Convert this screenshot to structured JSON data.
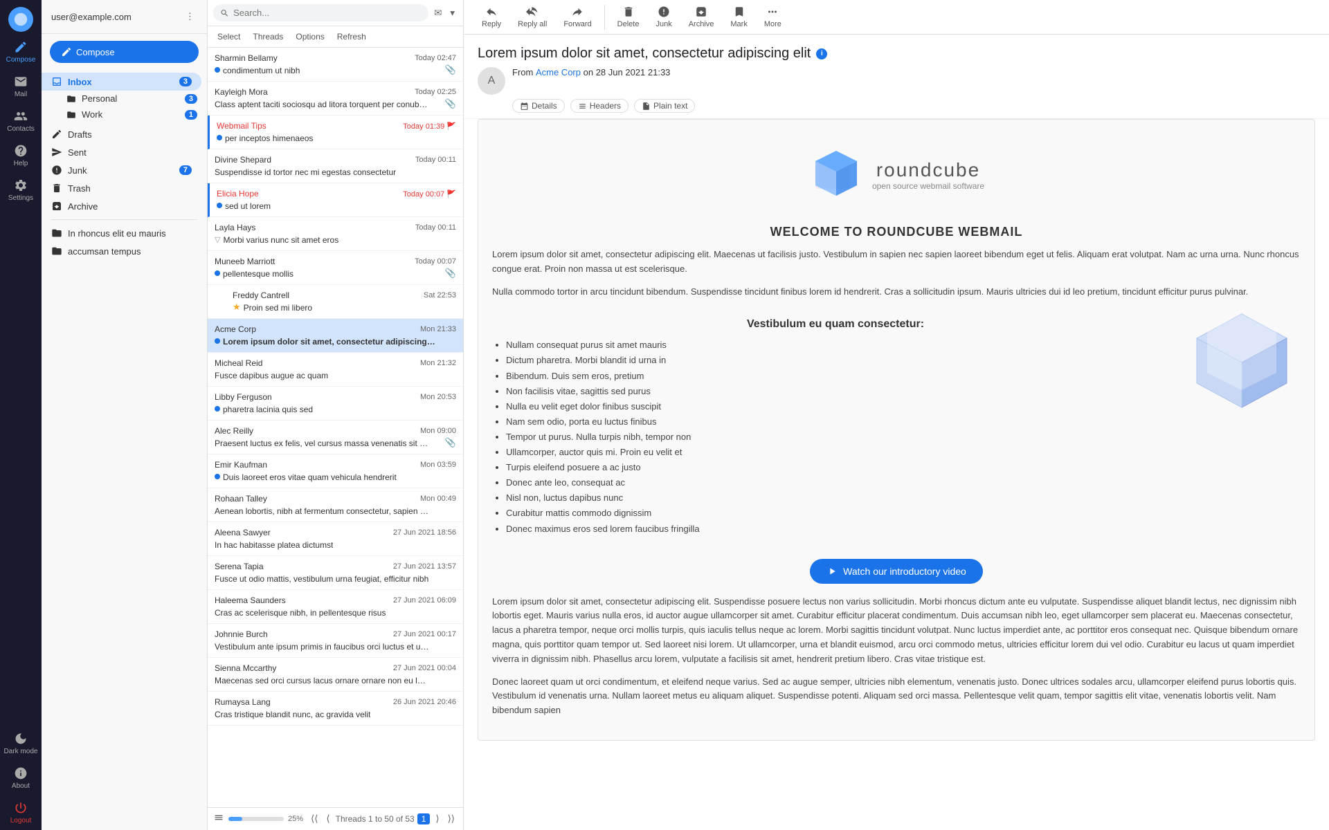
{
  "app": {
    "user": "user@example.com",
    "logo_alt": "Roundcube"
  },
  "sidebar": {
    "items": [
      {
        "id": "compose",
        "label": "Compose",
        "icon": "compose-icon",
        "active": true
      },
      {
        "id": "mail",
        "label": "Mail",
        "icon": "mail-icon",
        "active": false
      },
      {
        "id": "contacts",
        "label": "Contacts",
        "icon": "contacts-icon",
        "active": false
      },
      {
        "id": "help",
        "label": "Help",
        "icon": "help-icon",
        "active": false
      },
      {
        "id": "settings",
        "label": "Settings",
        "icon": "settings-icon",
        "active": false
      }
    ],
    "bottom_items": [
      {
        "id": "dark-mode",
        "label": "Dark mode",
        "icon": "moon-icon"
      },
      {
        "id": "about",
        "label": "About",
        "icon": "question-icon"
      },
      {
        "id": "logout",
        "label": "Logout",
        "icon": "power-icon"
      }
    ]
  },
  "nav": {
    "inbox_label": "Inbox",
    "inbox_badge": "3",
    "folders": [
      {
        "id": "personal",
        "label": "Personal",
        "badge": "3",
        "indent": true
      },
      {
        "id": "work",
        "label": "Work",
        "badge": "1",
        "indent": true
      },
      {
        "id": "drafts",
        "label": "Drafts",
        "badge": null,
        "indent": false
      },
      {
        "id": "sent",
        "label": "Sent",
        "badge": null,
        "indent": false
      },
      {
        "id": "junk",
        "label": "Junk",
        "badge": "7",
        "indent": false
      },
      {
        "id": "trash",
        "label": "Trash",
        "badge": null,
        "indent": false
      },
      {
        "id": "archive",
        "label": "Archive",
        "badge": null,
        "indent": false
      },
      {
        "id": "inrhoncus",
        "label": "In rhoncus elit eu mauris",
        "badge": null,
        "indent": false
      },
      {
        "id": "accumsan",
        "label": "accumsan tempus",
        "badge": null,
        "indent": false
      }
    ]
  },
  "toolbar": {
    "reply_label": "Reply",
    "reply_all_label": "Reply all",
    "forward_label": "Forward",
    "delete_label": "Delete",
    "junk_label": "Junk",
    "archive_label": "Archive",
    "mark_label": "Mark",
    "more_label": "More"
  },
  "email_list": {
    "search_placeholder": "Search...",
    "toolbar_buttons": [
      "Select",
      "Threads",
      "Options",
      "Refresh"
    ],
    "footer_text": "Threads 1 to 50 of 53",
    "footer_page": "1",
    "progress_percent": 25,
    "emails": [
      {
        "sender": "Sharmin Bellamy",
        "time": "Today 02:47",
        "subject": "condimentum ut nibh",
        "unread": true,
        "flag": false,
        "attach": true,
        "selected": false,
        "indent": 0
      },
      {
        "sender": "Kayleigh Mora",
        "time": "Today 02:25",
        "subject": "Class aptent taciti sociosqu ad litora torquent per conubia nostra",
        "unread": false,
        "flag": false,
        "attach": true,
        "selected": false,
        "indent": 0
      },
      {
        "sender": "Webmail Tips",
        "time": "Today 01:39",
        "subject": "per inceptos himenaeos",
        "unread": true,
        "flag": true,
        "attach": false,
        "selected": false,
        "indent": 0,
        "flagged": true,
        "sender_color": "#e53935"
      },
      {
        "sender": "Divine Shepard",
        "time": "Today 00:11",
        "subject": "Suspendisse id tortor nec mi egestas consectetur",
        "unread": false,
        "flag": false,
        "attach": false,
        "selected": false,
        "indent": 0
      },
      {
        "sender": "Elicia Hope",
        "time": "Today 00:07",
        "subject": "sed ut lorem",
        "unread": true,
        "flag": true,
        "attach": false,
        "selected": false,
        "indent": 0,
        "sender_color": "#e53935"
      },
      {
        "sender": "Layla Hays",
        "time": "Today 00:11",
        "subject": "Morbi varius nunc sit amet eros",
        "unread": false,
        "flag": false,
        "attach": false,
        "selected": false,
        "indent": 0,
        "is_thread": true
      },
      {
        "sender": "Muneeb Marriott",
        "time": "Today 00:07",
        "subject": "pellentesque mollis",
        "unread": true,
        "flag": false,
        "attach": true,
        "selected": false,
        "indent": 1
      },
      {
        "sender": "Freddy Cantrell",
        "time": "Sat 22:53",
        "subject": "Proin sed mi libero",
        "unread": false,
        "flag": true,
        "attach": false,
        "selected": false,
        "indent": 2,
        "star": true
      },
      {
        "sender": "Acme Corp",
        "time": "Mon 21:33",
        "subject": "Lorem ipsum dolor sit amet, consectetur adipiscing elit",
        "unread": true,
        "flag": false,
        "attach": false,
        "selected": true,
        "indent": 0
      },
      {
        "sender": "Micheal Reid",
        "time": "Mon 21:32",
        "subject": "Fusce dapibus augue ac quam",
        "unread": false,
        "flag": false,
        "attach": false,
        "selected": false,
        "indent": 0
      },
      {
        "sender": "Libby Ferguson",
        "time": "Mon 20:53",
        "subject": "pharetra lacinia quis sed",
        "unread": true,
        "flag": false,
        "attach": false,
        "selected": false,
        "indent": 0
      },
      {
        "sender": "Alec Reilly",
        "time": "Mon 09:00",
        "subject": "Praesent luctus ex felis, vel cursus massa venenatis sit amet",
        "unread": false,
        "flag": false,
        "attach": true,
        "selected": false,
        "indent": 0
      },
      {
        "sender": "Emir Kaufman",
        "time": "Mon 03:59",
        "subject": "Duis laoreet eros vitae quam vehicula hendrerit",
        "unread": true,
        "flag": false,
        "attach": false,
        "selected": false,
        "indent": 0
      },
      {
        "sender": "Rohaan Talley",
        "time": "Mon 00:49",
        "subject": "Aenean lobortis, nibh at fermentum consectetur, sapien augue vol...",
        "unread": false,
        "flag": false,
        "attach": false,
        "selected": false,
        "indent": 0
      },
      {
        "sender": "Aleena Sawyer",
        "time": "27 Jun 2021 18:56",
        "subject": "In hac habitasse platea dictumst",
        "unread": false,
        "flag": false,
        "attach": false,
        "selected": false,
        "indent": 0
      },
      {
        "sender": "Serena Tapia",
        "time": "27 Jun 2021 13:57",
        "subject": "Fusce ut odio mattis, vestibulum urna feugiat, efficitur nibh",
        "unread": false,
        "flag": false,
        "attach": false,
        "selected": false,
        "indent": 0
      },
      {
        "sender": "Haleema Saunders",
        "time": "27 Jun 2021 06:09",
        "subject": "Cras ac scelerisque nibh, in pellentesque risus",
        "unread": false,
        "flag": false,
        "attach": false,
        "selected": false,
        "indent": 0
      },
      {
        "sender": "Johnnie Burch",
        "time": "27 Jun 2021 00:17",
        "subject": "Vestibulum ante ipsum primis in faucibus orci luctus et ultrices pos...",
        "unread": false,
        "flag": false,
        "attach": false,
        "selected": false,
        "indent": 0
      },
      {
        "sender": "Sienna Mccarthy",
        "time": "27 Jun 2021 00:04",
        "subject": "Maecenas sed orci cursus lacus ornare ornare non eu lectus",
        "unread": false,
        "flag": false,
        "attach": false,
        "selected": false,
        "indent": 0
      },
      {
        "sender": "Rumaysa Lang",
        "time": "26 Jun 2021 20:46",
        "subject": "Cras tristique blandit nunc, ac gravida velit",
        "unread": false,
        "flag": false,
        "attach": false,
        "selected": false,
        "indent": 0
      }
    ]
  },
  "reader": {
    "subject": "Lorem ipsum dolor sit amet, consectetur adipiscing elit",
    "from_label": "From",
    "from_name": "Acme Corp",
    "from_date": "on 28 Jun 2021 21:33",
    "tags": [
      {
        "id": "details",
        "label": "Details"
      },
      {
        "id": "headers",
        "label": "Headers"
      },
      {
        "id": "plain-text",
        "label": "Plain text"
      }
    ],
    "body": {
      "logo_title": "roundcube",
      "logo_subtitle": "open source webmail software",
      "welcome_heading": "WELCOME TO ROUNDCUBE WEBMAIL",
      "intro_p1": "Lorem ipsum dolor sit amet, consectetur adipiscing elit. Maecenas ut facilisis justo. Vestibulum in sapien nec sapien laoreet bibendum eget ut felis. Aliquam erat volutpat. Nam ac urna urna. Nunc rhoncus congue erat. Proin non massa ut est scelerisque.",
      "intro_p2": "Nulla commodo tortor in arcu tincidunt bibendum. Suspendisse tincidunt finibus lorem id hendrerit. Cras a sollicitudin ipsum. Mauris ultricies dui id leo pretium, tincidunt efficitur purus pulvinar.",
      "section_title": "Vestibulum eu quam consectetur:",
      "list_items": [
        "Nullam consequat purus sit amet mauris",
        "Dictum pharetra. Morbi blandit id urna in",
        "Bibendum. Duis sem eros, pretium",
        "Non facilisis vitae, sagittis sed purus",
        "Nulla eu velit eget dolor finibus suscipit",
        "Nam sem odio, porta eu luctus finibus",
        "Tempor ut purus. Nulla turpis nibh, tempor non",
        "Ullamcorper, auctor quis mi. Proin eu velit et",
        "Turpis eleifend posuere a ac justo",
        "Donec ante leo, consequat ac",
        "Nisl non, luctus dapibus nunc",
        "Curabitur mattis commodo dignissim",
        "Donec maximus eros sed lorem faucibus fringilla"
      ],
      "video_btn_label": "Watch our introductory video",
      "body_p3": "Lorem ipsum dolor sit amet, consectetur adipiscing elit. Suspendisse posuere lectus non varius sollicitudin. Morbi rhoncus dictum ante eu vulputate. Suspendisse aliquet blandit lectus, nec dignissim nibh lobortis eget. Mauris varius nulla eros, id auctor augue ullamcorper sit amet. Curabitur efficitur placerat condimentum. Duis accumsan nibh leo, eget ullamcorper sem placerat eu. Maecenas consectetur, lacus a pharetra tempor, neque orci mollis turpis, quis iaculis tellus neque ac lorem. Morbi sagittis tincidunt volutpat. Nunc luctus imperdiet ante, ac porttitor eros consequat nec. Quisque bibendum ornare magna, quis porttitor quam tempor ut. Sed laoreet nisi lorem. Ut ullamcorper, urna et blandit euismod, arcu orci commodo metus, ultricies efficitur lorem dui vel odio. Curabitur eu lacus ut quam imperdiet viverra in dignissim nibh. Phasellus arcu lorem, vulputate a facilisis sit amet, hendrerit pretium libero. Cras vitae tristique est.",
      "body_p4": "Donec laoreet quam ut orci condimentum, et eleifend neque varius. Sed ac augue semper, ultricies nibh elementum, venenatis justo. Donec ultrices sodales arcu, ullamcorper eleifend purus lobortis quis. Vestibulum id venenatis urna. Nullam laoreet metus eu aliquam aliquet. Suspendisse potenti. Aliquam sed orci massa. Pellentesque velit quam, tempor sagittis elit vitae, venenatis lobortis velit. Nam bibendum sapien"
    }
  }
}
